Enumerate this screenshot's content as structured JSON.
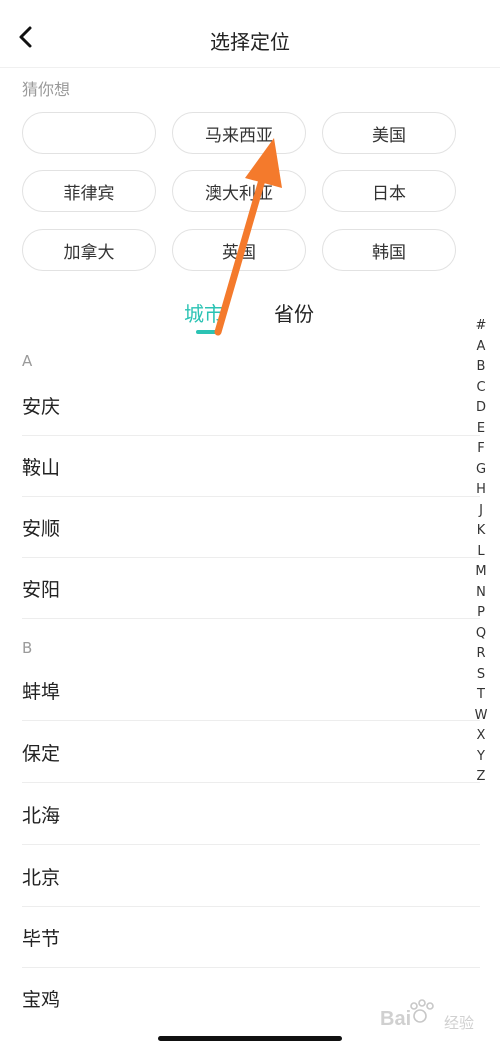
{
  "header": {
    "title": "选择定位",
    "back_icon": "chevron-left-icon"
  },
  "guess": {
    "label": "猜你想",
    "chips": [
      "",
      "马来西亚",
      "美国",
      "菲律宾",
      "澳大利亚",
      "日本",
      "加拿大",
      "英国",
      "韩国"
    ]
  },
  "tabs": {
    "city": "城市",
    "province": "省份",
    "active": "city"
  },
  "sections": [
    {
      "letter": "A",
      "cities": [
        "安庆",
        "鞍山",
        "安顺",
        "安阳"
      ]
    },
    {
      "letter": "B",
      "cities": [
        "蚌埠",
        "保定",
        "北海",
        "北京",
        "毕节",
        "宝鸡"
      ]
    }
  ],
  "index": [
    "#",
    "A",
    "B",
    "C",
    "D",
    "E",
    "F",
    "G",
    "H",
    "J",
    "K",
    "L",
    "M",
    "N",
    "P",
    "Q",
    "R",
    "S",
    "T",
    "W",
    "X",
    "Y",
    "Z"
  ],
  "colors": {
    "accent": "#2bc3b4",
    "annotation_arrow": "#f47a2c"
  },
  "watermark": {
    "brand": "Bai",
    "paw_icon": "baidu-paw-icon",
    "suffix": "经验"
  }
}
